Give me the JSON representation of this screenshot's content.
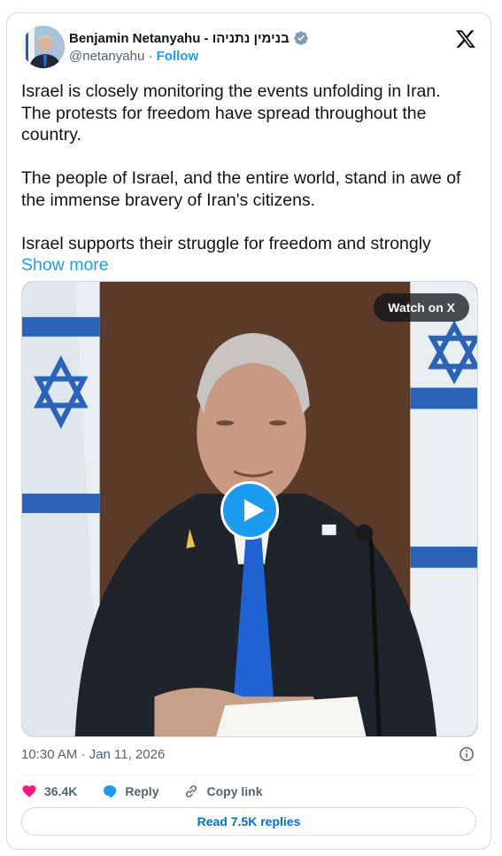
{
  "author": {
    "display_name": "Benjamin Netanyahu - בנימין נתניהו",
    "handle": "@netanyahu",
    "separator": "·",
    "follow_label": "Follow",
    "verified": true
  },
  "tweet": {
    "paragraphs": [
      "Israel is closely monitoring the events unfolding in Iran. The protests for freedom have spread throughout the country.",
      "The people of Israel, and the entire world, stand in awe of the immense bravery of Iran's citizens.",
      "Israel supports their struggle for freedom and strongly"
    ],
    "show_more_label": "Show more"
  },
  "media": {
    "watch_label": "Watch on X",
    "play_icon": "play-icon"
  },
  "meta": {
    "timestamp": "10:30 AM · Jan 11, 2026"
  },
  "actions": {
    "likes": "36.4K",
    "reply_label": "Reply",
    "copy_link_label": "Copy link",
    "read_replies_label": "Read 7.5K replies"
  },
  "colors": {
    "accent": "#1d9bf0",
    "like": "#f91880",
    "text": "#0f1419",
    "secondary": "#536471"
  }
}
